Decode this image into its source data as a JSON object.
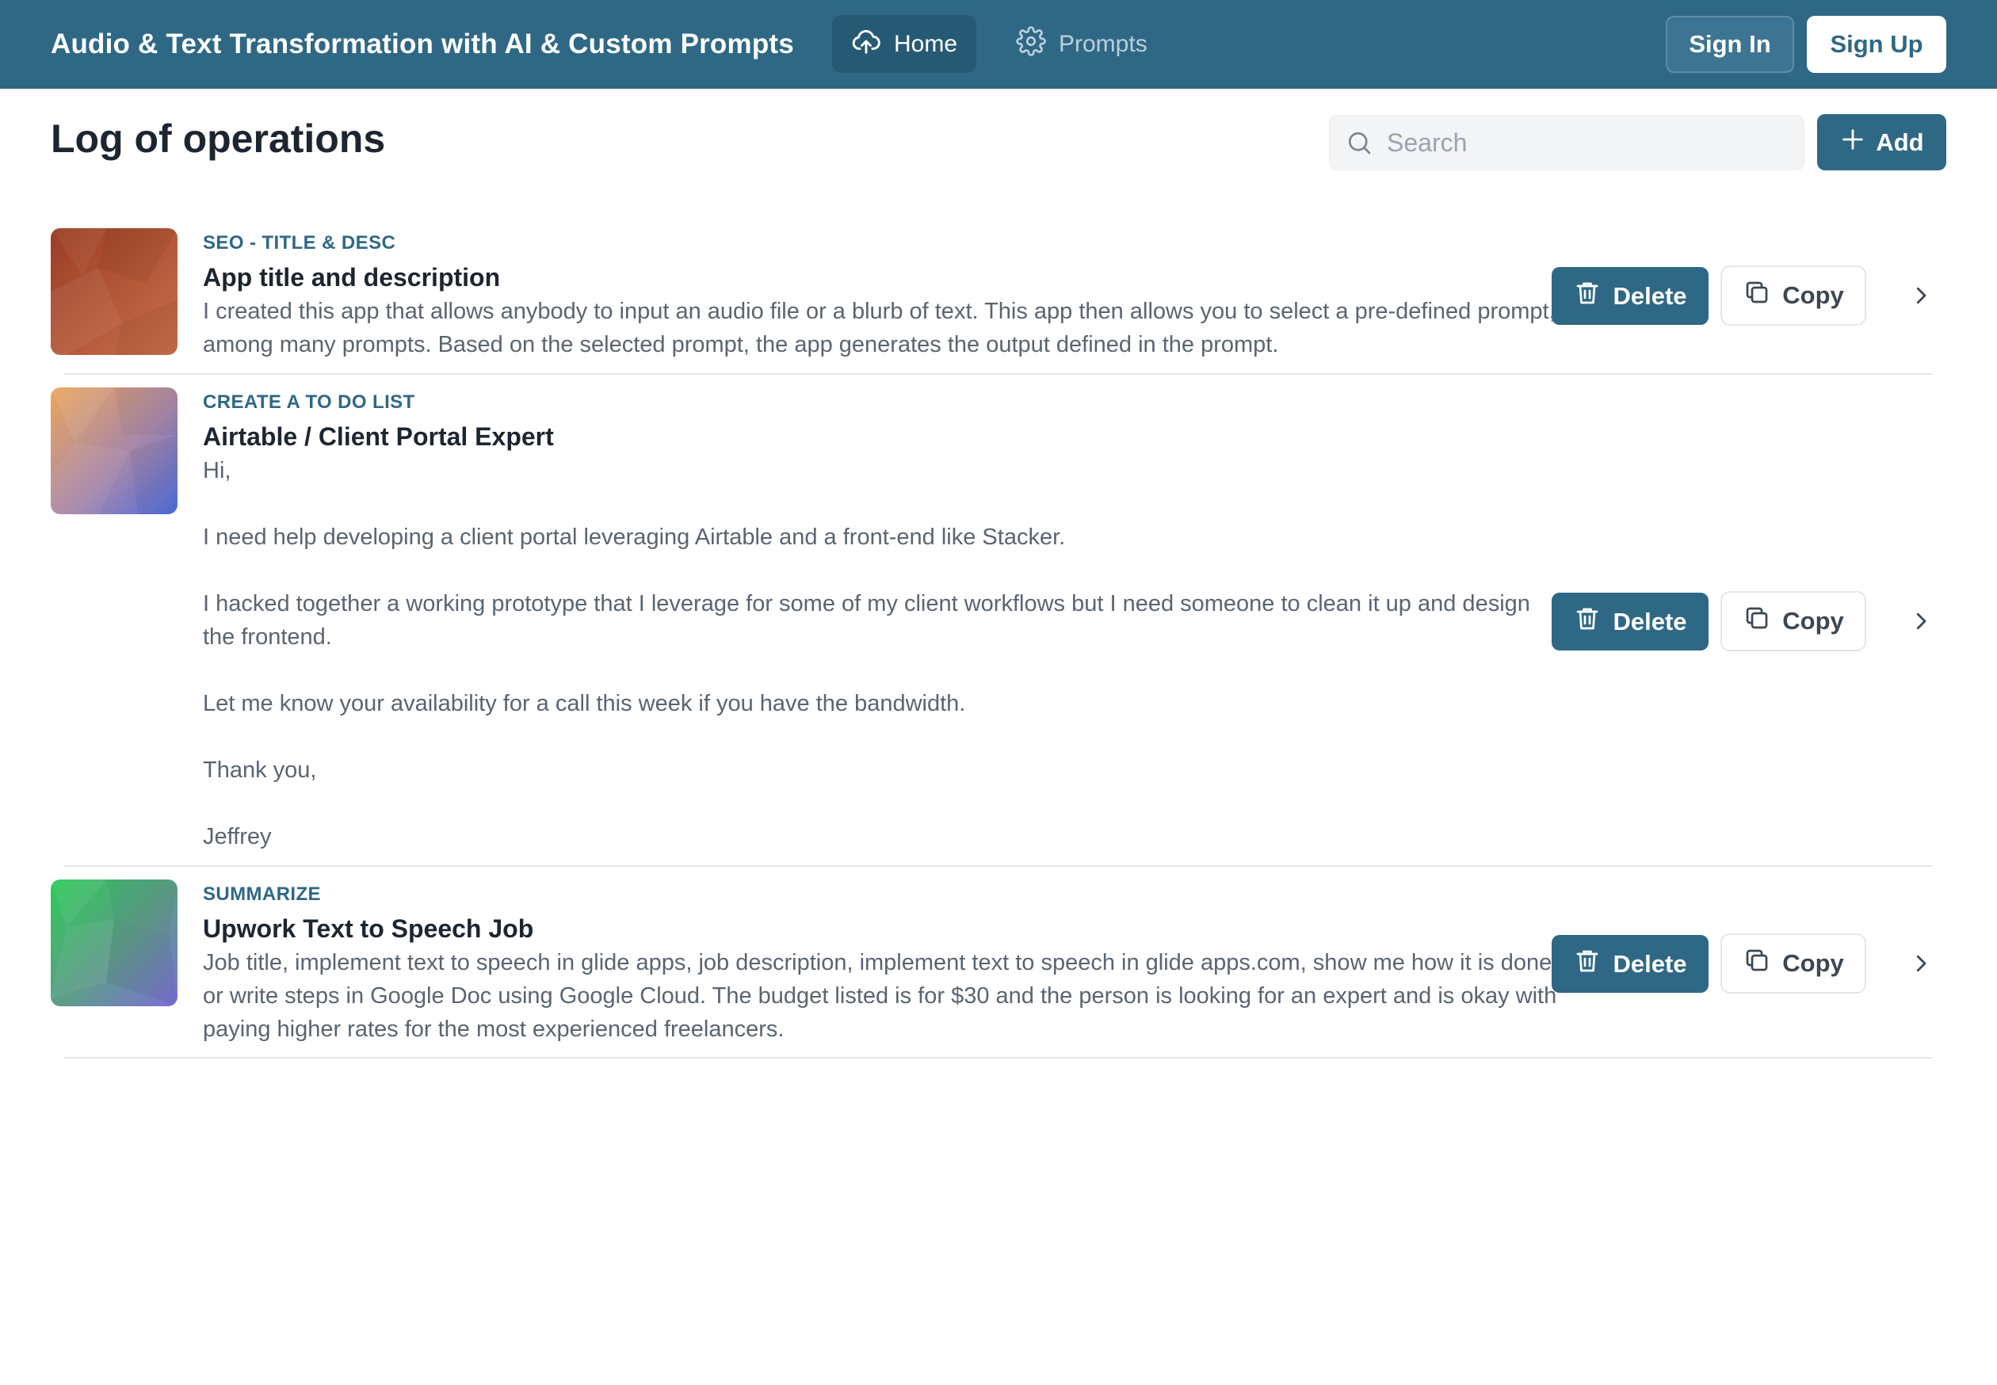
{
  "header": {
    "app_title": "Audio & Text Transformation with AI & Custom Prompts",
    "nav": [
      {
        "label": "Home",
        "icon": "cloud-upload-icon",
        "active": true
      },
      {
        "label": "Prompts",
        "icon": "gear-icon",
        "active": false
      }
    ],
    "sign_in_label": "Sign In",
    "sign_up_label": "Sign Up"
  },
  "page": {
    "title": "Log of operations",
    "search": {
      "placeholder": "Search",
      "value": "",
      "icon": "search-icon"
    },
    "add_label": "Add"
  },
  "actions": {
    "delete_label": "Delete",
    "copy_label": "Copy"
  },
  "items": [
    {
      "category": "SEO - Title & Desc",
      "title": "App title and description",
      "body": "I created this app that allows anybody to input an audio file or a blurb of text. This app then allows you to select a pre-defined prompt, among many prompts. Based on the selected prompt, the app generates the output defined in the prompt.",
      "thumbnail_colors": [
        "#a9472a",
        "#c4643e"
      ]
    },
    {
      "category": "Create a to do list",
      "title": "Airtable / Client Portal Expert",
      "body": "Hi,\n\nI need help developing a client portal leveraging Airtable and a front-end like Stacker.\n\nI hacked together a working prototype that I leverage for some of my client workflows but I need someone to clean it up and design the frontend.\n\nLet me know your availability for a call this week if you have the bandwidth.\n\nThank you,\n\nJeffrey",
      "thumbnail_colors": [
        "#e9a85a",
        "#5f79d8"
      ]
    },
    {
      "category": "Summarize",
      "title": "Upwork Text to Speech Job",
      "body": "Job title, implement text to speech in glide apps, job description, implement text to speech in glide apps.com, show me how it is done or write steps in Google Doc using Google Cloud. The budget listed is for $30 and the person is looking for an expert and is okay with paying higher rates for the most experienced freelancers.",
      "thumbnail_colors": [
        "#36c45e",
        "#7b6fd6"
      ]
    }
  ],
  "colors": {
    "primary": "#2f6885",
    "header_bg": "#2f6885",
    "text_muted": "#5b6470"
  }
}
